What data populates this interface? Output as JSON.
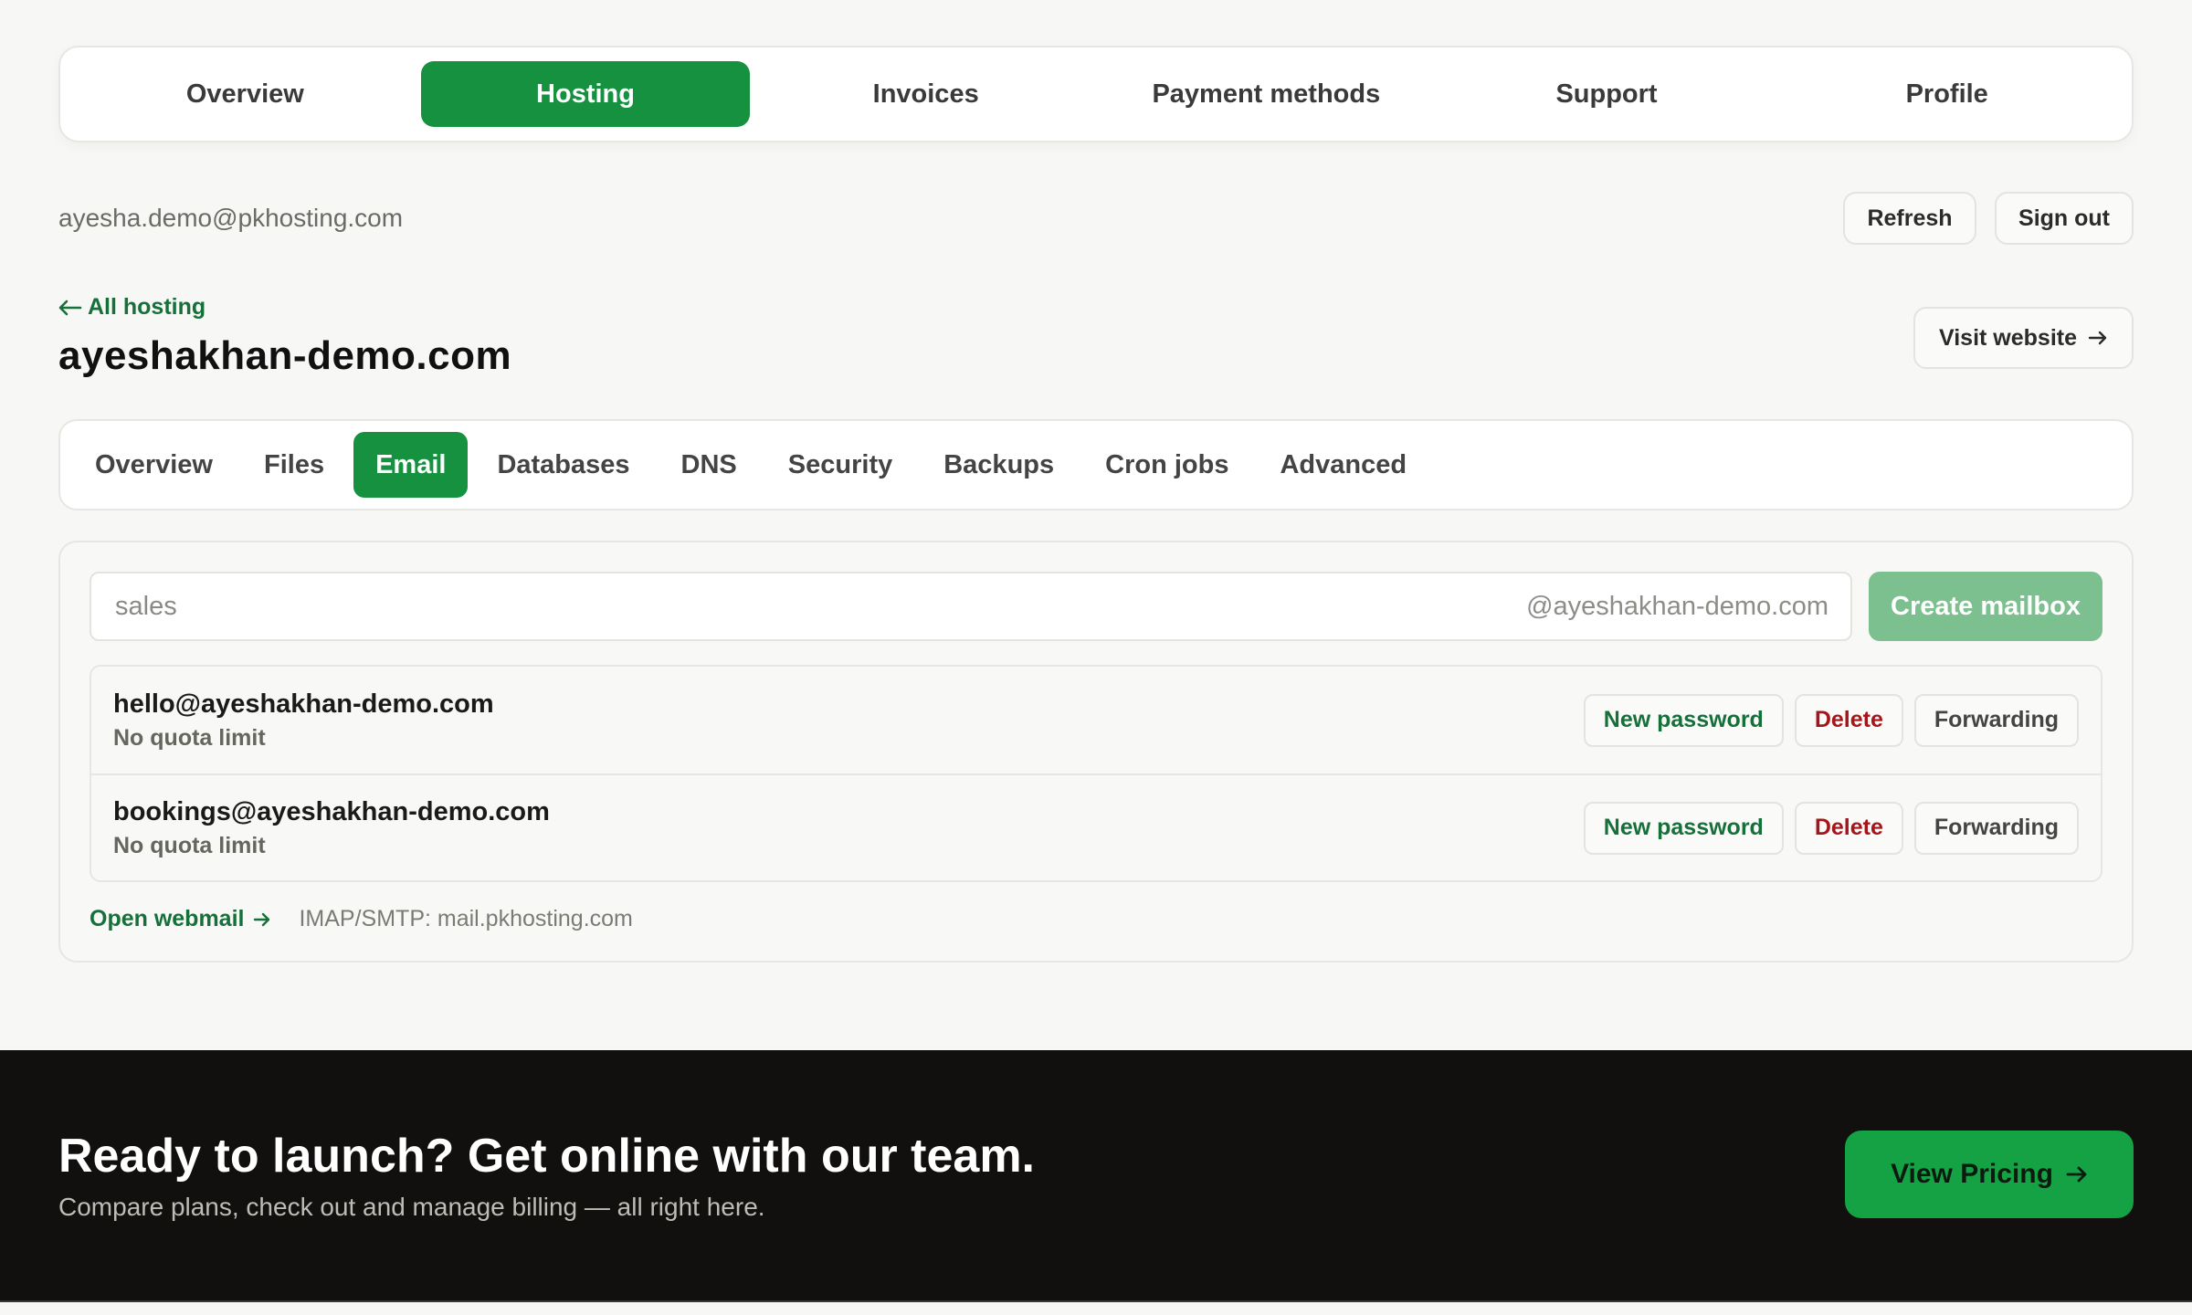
{
  "topnav": {
    "tabs": [
      {
        "label": "Overview"
      },
      {
        "label": "Hosting",
        "active": true
      },
      {
        "label": "Invoices"
      },
      {
        "label": "Payment methods"
      },
      {
        "label": "Support"
      },
      {
        "label": "Profile"
      }
    ]
  },
  "account": {
    "email": "ayesha.demo@pkhosting.com",
    "refresh_label": "Refresh",
    "signout_label": "Sign out"
  },
  "site": {
    "back_label": "All hosting",
    "back_icon": "arrow-left-icon",
    "title": "ayeshakhan-demo.com",
    "visit_label": "Visit website",
    "visit_icon": "arrow-right-icon"
  },
  "subnav": {
    "tabs": [
      {
        "label": "Overview"
      },
      {
        "label": "Files"
      },
      {
        "label": "Email",
        "active": true
      },
      {
        "label": "Databases"
      },
      {
        "label": "DNS"
      },
      {
        "label": "Security"
      },
      {
        "label": "Backups"
      },
      {
        "label": "Cron jobs"
      },
      {
        "label": "Advanced"
      }
    ]
  },
  "email_panel": {
    "input_placeholder": "sales",
    "domain_suffix": "@ayeshakhan-demo.com",
    "create_label": "Create mailbox",
    "mailboxes": [
      {
        "address": "hello@ayeshakhan-demo.com",
        "quota": "No quota limit"
      },
      {
        "address": "bookings@ayeshakhan-demo.com",
        "quota": "No quota limit"
      }
    ],
    "actions": {
      "new_password": "New password",
      "delete": "Delete",
      "forwarding": "Forwarding"
    },
    "webmail_label": "Open webmail",
    "imap_text": "IMAP/SMTP: mail.pkhosting.com"
  },
  "footer": {
    "title": "Ready to launch? Get online with our team.",
    "subtitle": "Compare plans, check out and manage billing — all right here.",
    "cta_label": "View Pricing"
  },
  "colors": {
    "brand_green": "#15913f",
    "link_green": "#15703a",
    "danger_red": "#a4161a",
    "footer_bg": "#12100e"
  }
}
